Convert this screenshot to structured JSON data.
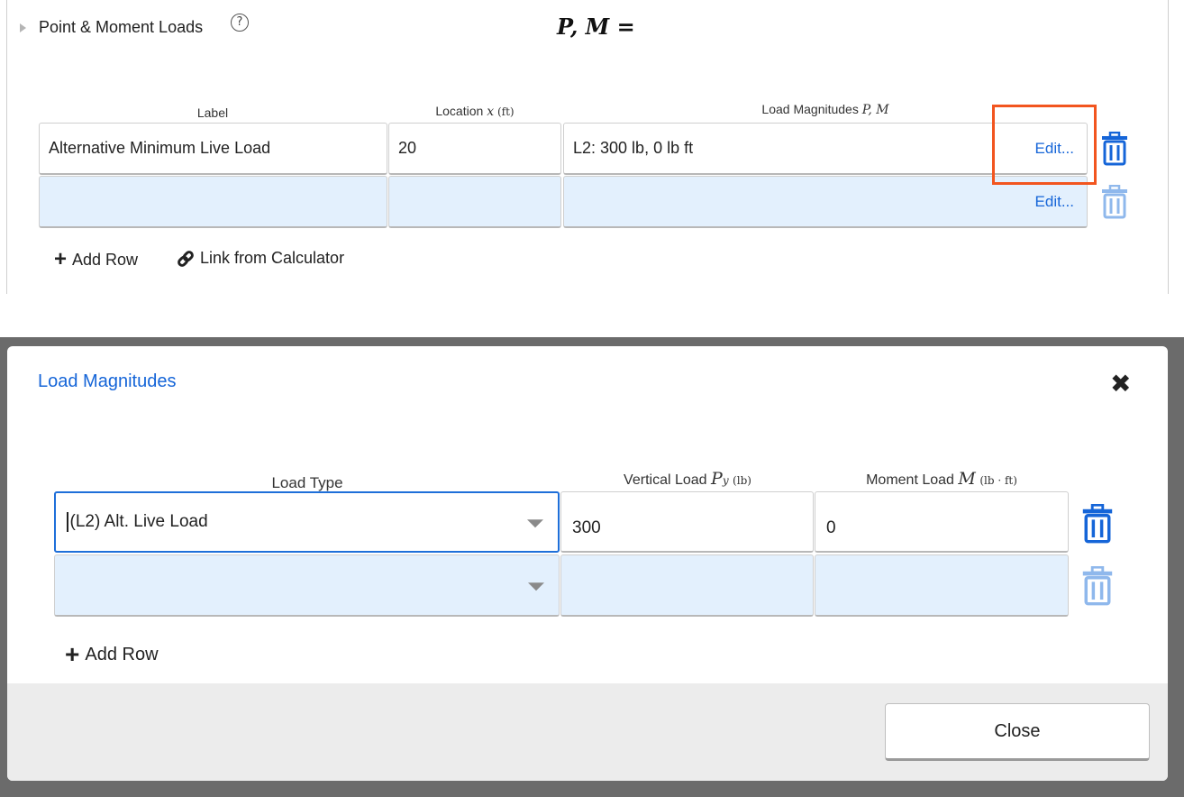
{
  "section": {
    "title": "Point & Moment Loads",
    "help": "?",
    "equation": "P, M ="
  },
  "table": {
    "columns": {
      "label": "Label",
      "location": "Location",
      "location_var": "x",
      "location_unit": "(ft)",
      "magnitudes": "Load Magnitudes",
      "magnitudes_var": "P, M"
    },
    "rows": [
      {
        "label": "Alternative Minimum Live Load",
        "location": "20",
        "magnitudes": "L2: 300 lb, 0 lb ft",
        "edit": "Edit..."
      },
      {
        "label": "",
        "location": "",
        "magnitudes": "",
        "edit": "Edit..."
      }
    ],
    "add_row": "Add Row",
    "link_from_calculator": "Link from Calculator"
  },
  "dialog": {
    "title": "Load Magnitudes",
    "columns": {
      "load_type": "Load Type",
      "vertical": "Vertical Load",
      "vertical_var": "P",
      "vertical_sub": "y",
      "vertical_unit": "(lb)",
      "moment": "Moment Load",
      "moment_var": "M",
      "moment_unit": "(lb · ft)"
    },
    "rows": [
      {
        "load_type": "(L2) Alt. Live Load",
        "vertical": "300",
        "moment": "0"
      },
      {
        "load_type": "",
        "vertical": "",
        "moment": ""
      }
    ],
    "add_row": "Add Row",
    "close": "Close"
  },
  "colors": {
    "accent": "#1565d8",
    "highlight": "#f2551f",
    "empty_row": "#e3f0fd"
  }
}
